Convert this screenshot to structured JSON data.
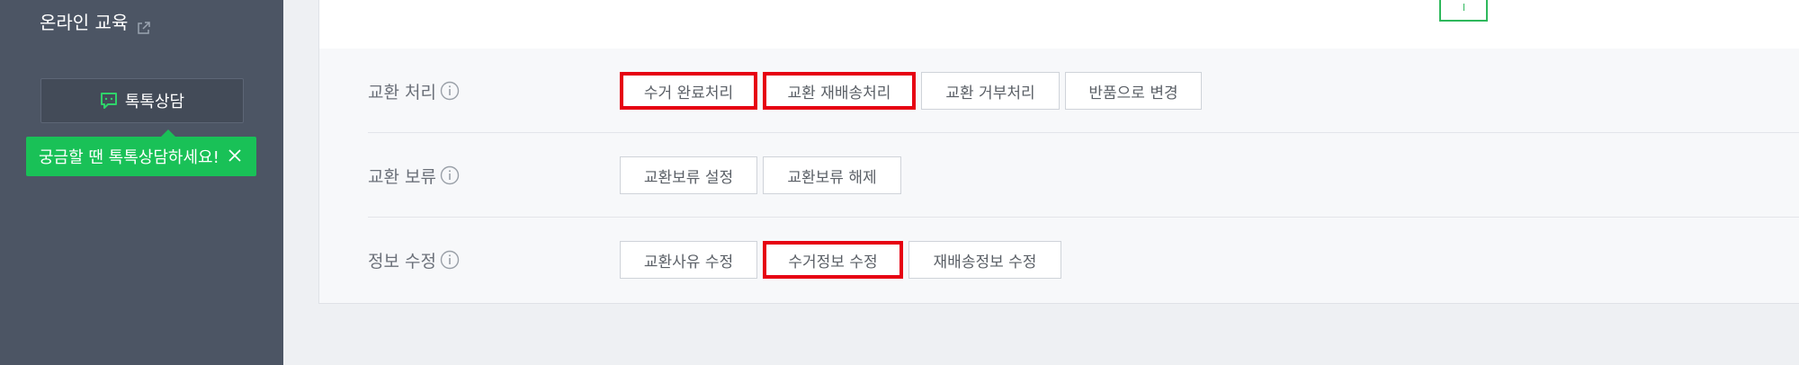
{
  "sidebar": {
    "online_education": "온라인 교육",
    "talk_button": "톡톡상담",
    "tooltip_text": "궁금할 땐 톡톡상담하세요!"
  },
  "rows": [
    {
      "label": "교환 처리",
      "buttons": [
        "수거 완료처리",
        "교환 재배송처리",
        "교환 거부처리",
        "반품으로 변경"
      ]
    },
    {
      "label": "교환 보류",
      "buttons": [
        "교환보류 설정",
        "교환보류 해제"
      ]
    },
    {
      "label": "정보 수정",
      "buttons": [
        "교환사유 수정",
        "수거정보 수정",
        "재배송정보 수정"
      ]
    }
  ],
  "colors": {
    "sidebar_bg": "#4c5564",
    "tooltip_bg": "#19c157",
    "highlight": "#e60012"
  }
}
